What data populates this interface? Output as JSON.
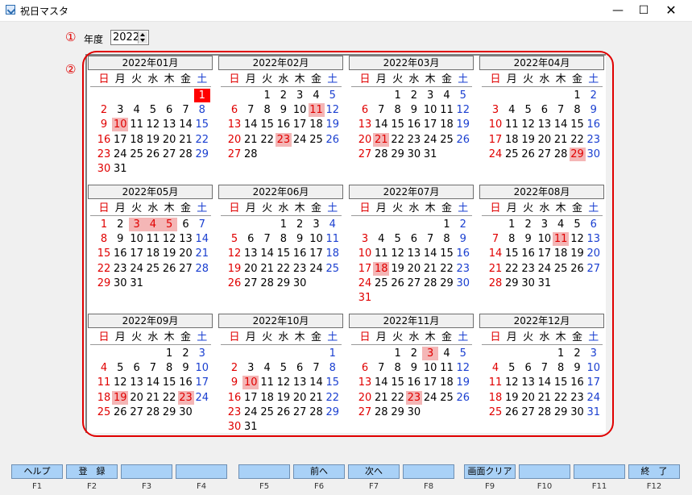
{
  "window": {
    "title": "祝日マスタ"
  },
  "markers": {
    "one": "①",
    "two": "②"
  },
  "year": {
    "label": "年度",
    "value": "2022"
  },
  "weekdays": [
    "日",
    "月",
    "火",
    "水",
    "木",
    "金",
    "土"
  ],
  "colors": {
    "sunday": "#e00000",
    "saturday": "#1a3fd0",
    "weekday": "#000000",
    "holiday_bg": "#f4b6b6",
    "selected_bg": "#ff0000",
    "selected_fg": "#ffffff"
  },
  "months": [
    {
      "title": "2022年01月",
      "start": 6,
      "days": 31,
      "holidays": [
        10
      ],
      "selected": 1
    },
    {
      "title": "2022年02月",
      "start": 2,
      "days": 28,
      "holidays": [
        11,
        23
      ]
    },
    {
      "title": "2022年03月",
      "start": 2,
      "days": 31,
      "holidays": [
        21
      ]
    },
    {
      "title": "2022年04月",
      "start": 5,
      "days": 30,
      "holidays": [
        29
      ]
    },
    {
      "title": "2022年05月",
      "start": 0,
      "days": 31,
      "holidays": [
        3,
        4,
        5
      ]
    },
    {
      "title": "2022年06月",
      "start": 3,
      "days": 30,
      "holidays": []
    },
    {
      "title": "2022年07月",
      "start": 5,
      "days": 31,
      "holidays": [
        18
      ]
    },
    {
      "title": "2022年08月",
      "start": 1,
      "days": 31,
      "holidays": [
        11
      ]
    },
    {
      "title": "2022年09月",
      "start": 4,
      "days": 30,
      "holidays": [
        19,
        23
      ]
    },
    {
      "title": "2022年10月",
      "start": 6,
      "days": 31,
      "holidays": [
        10
      ]
    },
    {
      "title": "2022年11月",
      "start": 2,
      "days": 30,
      "holidays": [
        3,
        23
      ]
    },
    {
      "title": "2022年12月",
      "start": 4,
      "days": 31,
      "holidays": []
    }
  ],
  "fkeys": [
    {
      "label": "ヘルプ",
      "key": "F1"
    },
    {
      "label": "登　録",
      "key": "F2"
    },
    {
      "label": "",
      "key": "F3"
    },
    {
      "label": "",
      "key": "F4"
    },
    {
      "label": "",
      "key": "F5"
    },
    {
      "label": "前へ",
      "key": "F6"
    },
    {
      "label": "次へ",
      "key": "F7"
    },
    {
      "label": "",
      "key": "F8"
    },
    {
      "label": "画面クリア",
      "key": "F9"
    },
    {
      "label": "",
      "key": "F10"
    },
    {
      "label": "",
      "key": "F11"
    },
    {
      "label": "終　了",
      "key": "F12"
    }
  ]
}
